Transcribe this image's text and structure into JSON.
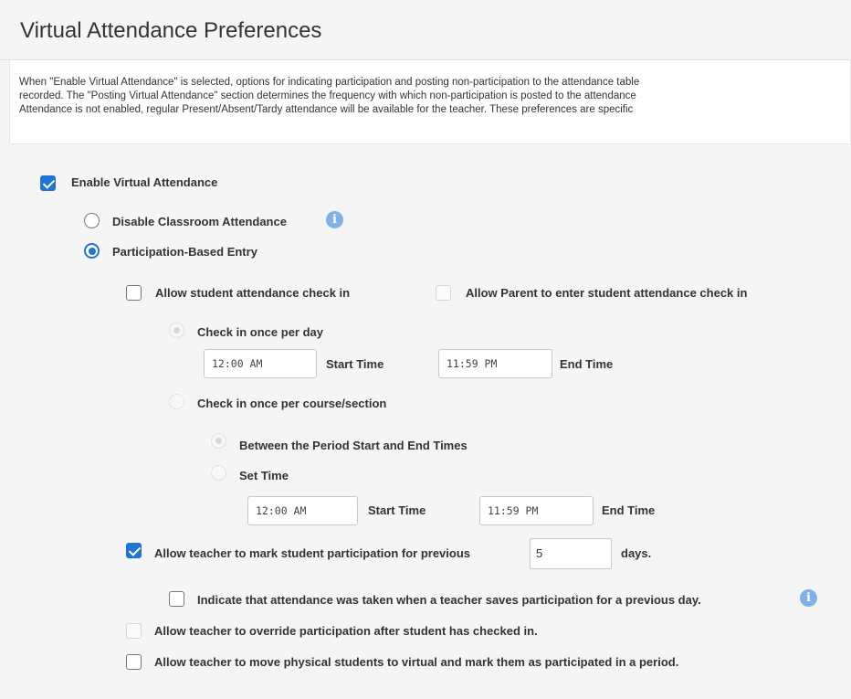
{
  "page": {
    "title": "Virtual Attendance Preferences"
  },
  "description": {
    "lines": [
      "When \"Enable Virtual Attendance\" is selected, options for indicating participation and posting non-participation to the attendance table",
      "recorded. The \"Posting Virtual Attendance\" section determines the frequency with which non-participation is posted to the attendance",
      "Attendance is not enabled, regular Present/Absent/Tardy attendance will be available for the teacher. These preferences are specific"
    ]
  },
  "settings": {
    "enable_virtual_attendance": {
      "label": "Enable Virtual Attendance",
      "checked": true
    },
    "mode": {
      "disable_classroom": {
        "label": "Disable Classroom Attendance",
        "selected": false
      },
      "participation_based": {
        "label": "Participation-Based Entry",
        "selected": true
      }
    },
    "allow_student_checkin": {
      "label": "Allow student attendance check in",
      "checked": false
    },
    "allow_parent_checkin": {
      "label": "Allow Parent to enter student attendance check in",
      "checked": false,
      "disabled": true
    },
    "checkin_once_per_day": {
      "label": "Check in once per day",
      "start_time": "12:00 AM",
      "start_label": "Start Time",
      "end_time": "11:59 PM",
      "end_label": "End Time"
    },
    "checkin_per_course": {
      "label": "Check in once per course/section"
    },
    "between_period": {
      "label": "Between the Period Start and End Times"
    },
    "set_time": {
      "label": "Set Time",
      "start_time": "12:00 AM",
      "start_label": "Start Time",
      "end_time": "11:59 PM",
      "end_label": "End Time"
    },
    "previous_days": {
      "label": "Allow teacher to mark student participation for previous",
      "value": "5",
      "unit": "days.",
      "checked": true
    },
    "indicate_taken": {
      "label": "Indicate that attendance was taken when a teacher saves participation for a previous day.",
      "checked": false
    },
    "override_participation": {
      "label": "Allow teacher to override participation after student has checked in.",
      "checked": false,
      "disabled": true
    },
    "move_physical": {
      "label": "Allow teacher to move physical students to virtual and mark them as participated in a period.",
      "checked": false
    }
  },
  "icons": {
    "info": "info-icon"
  },
  "colors": {
    "accent": "#1f74d4",
    "info": "#7fb0e6"
  }
}
